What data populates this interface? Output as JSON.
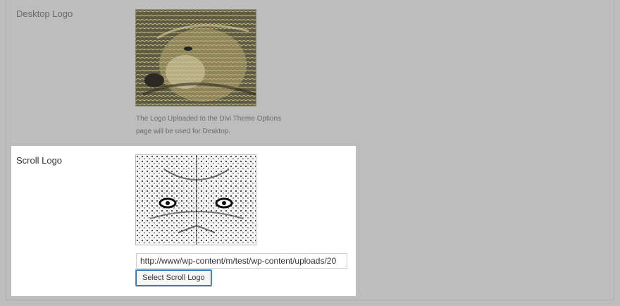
{
  "settings": {
    "desktop_logo": {
      "label": "Desktop Logo",
      "description_line1": "The Logo Uploaded to the Divi Theme Options",
      "description_line2": "page will be used for Desktop."
    },
    "scroll_logo": {
      "label": "Scroll Logo",
      "url_value": "http://www/wp-content/m/test/wp-content/uploads/20",
      "button_label": "Select Scroll Logo"
    }
  },
  "colors": {
    "page_background": "#bdbdbd",
    "active_section_background": "#ffffff",
    "button_focus_border": "#4f94d4"
  }
}
